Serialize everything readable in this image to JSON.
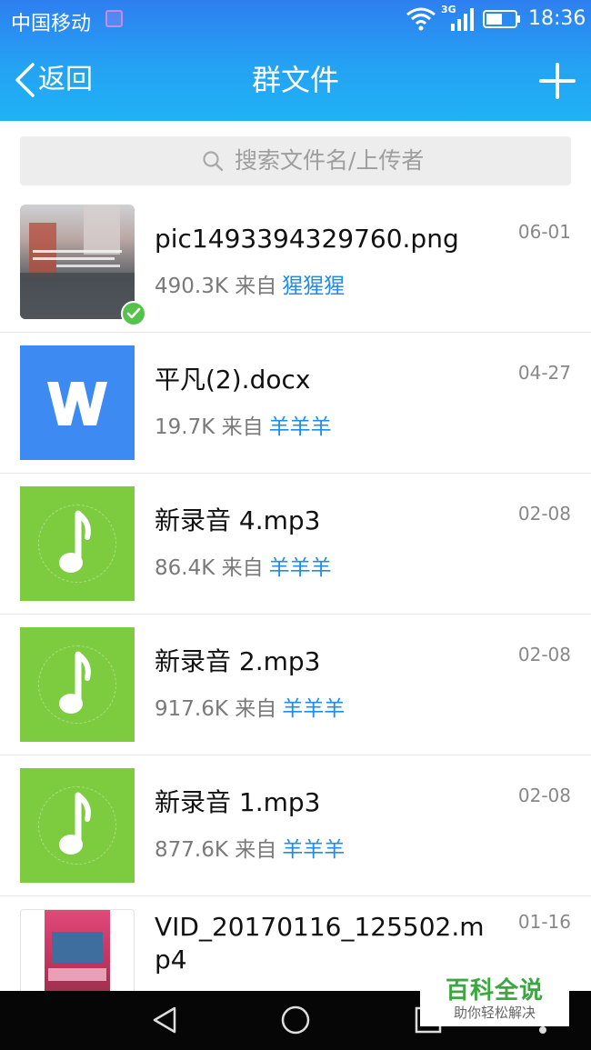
{
  "status_bar": {
    "carrier": "中国移动",
    "network_type": "3G",
    "time": "18:36"
  },
  "header": {
    "back_label": "返回",
    "title": "群文件",
    "add_icon": "plus-icon"
  },
  "search": {
    "placeholder": "搜索文件名/上传者",
    "icon": "search-icon"
  },
  "files": [
    {
      "name": "pic1493394329760.png",
      "size": "490.3K",
      "from_label": "来自",
      "uploader": "猩猩猩",
      "date": "06-01",
      "thumb": "image",
      "downloaded": true
    },
    {
      "name": "平凡(2).docx",
      "size": "19.7K",
      "from_label": "来自",
      "uploader": "羊羊羊",
      "date": "04-27",
      "thumb": "word-icon"
    },
    {
      "name": "新录音 4.mp3",
      "size": "86.4K",
      "from_label": "来自",
      "uploader": "羊羊羊",
      "date": "02-08",
      "thumb": "music-note-icon"
    },
    {
      "name": "新录音 2.mp3",
      "size": "917.6K",
      "from_label": "来自",
      "uploader": "羊羊羊",
      "date": "02-08",
      "thumb": "music-note-icon"
    },
    {
      "name": "新录音 1.mp3",
      "size": "877.6K",
      "from_label": "来自",
      "uploader": "羊羊羊",
      "date": "02-08",
      "thumb": "music-note-icon"
    },
    {
      "name": "VID_20170116_125502.mp4",
      "date": "01-16",
      "thumb": "video"
    }
  ],
  "watermark": {
    "title": "百科全说",
    "subtitle": "助你轻松解决"
  },
  "colors": {
    "header_gradient_top": "#2e7ff0",
    "header_gradient_bottom": "#1fb2f5",
    "uploader_link": "#1d8cea",
    "word_blue": "#3d8bf2",
    "music_green": "#7dcb3f",
    "check_green": "#55c34b"
  }
}
